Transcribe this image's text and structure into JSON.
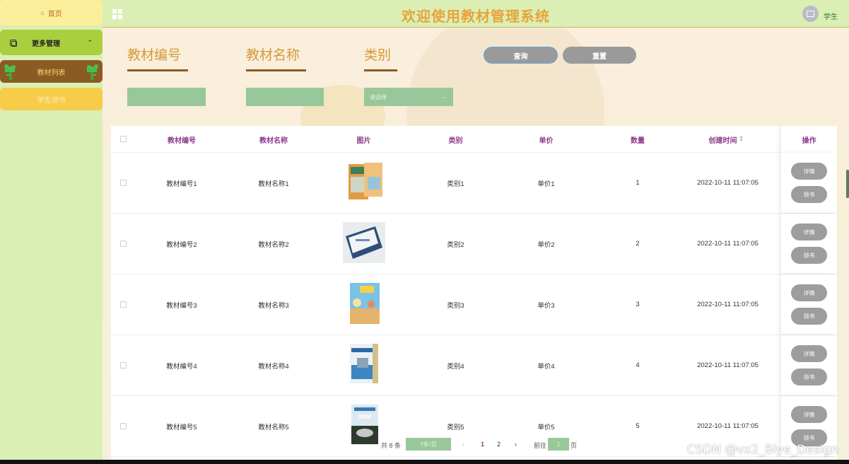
{
  "app": {
    "title": "欢迎使用教材管理系统",
    "user": "学生"
  },
  "sidebar": {
    "home": "首页",
    "group": "更多管理",
    "items": [
      {
        "label": "教材列表"
      },
      {
        "label": "学生领书"
      }
    ]
  },
  "search": {
    "field1_label": "教材编号",
    "field2_label": "教材名称",
    "field3_label": "类别",
    "select_placeholder": "请选择",
    "query_button": "查询",
    "reset_button": "重置"
  },
  "table": {
    "headers": [
      "教材编号",
      "教材名称",
      "图片",
      "类别",
      "单价",
      "数量",
      "创建时间",
      "操作"
    ],
    "rows": [
      {
        "code": "教材编号1",
        "name": "教材名称1",
        "category": "类别1",
        "price": "单价1",
        "qty": "1",
        "created": "2022-10-11 11:07:05"
      },
      {
        "code": "教材编号2",
        "name": "教材名称2",
        "category": "类别2",
        "price": "单价2",
        "qty": "2",
        "created": "2022-10-11 11:07:05"
      },
      {
        "code": "教材编号3",
        "name": "教材名称3",
        "category": "类别3",
        "price": "单价3",
        "qty": "3",
        "created": "2022-10-11 11:07:05"
      },
      {
        "code": "教材编号4",
        "name": "教材名称4",
        "category": "类别4",
        "price": "单价4",
        "qty": "4",
        "created": "2022-10-11 11:07:05"
      },
      {
        "code": "教材编号5",
        "name": "教材名称5",
        "category": "类别5",
        "price": "单价5",
        "qty": "5",
        "created": "2022-10-11 11:07:05"
      }
    ],
    "detail_button": "详情",
    "borrow_button": "领书"
  },
  "pagination": {
    "total": "共 8 条",
    "page_size": "7条/页",
    "pages": [
      "1",
      "2"
    ],
    "goto_label": "前往",
    "current": "1",
    "unit": "页"
  },
  "watermark": "CSDN @vx2_Biye_Design",
  "colors": {
    "accent": "#e8a33a",
    "sidebar": "#d9efb4",
    "active": "#8b5b24",
    "header_purple": "#8d3b8d"
  }
}
